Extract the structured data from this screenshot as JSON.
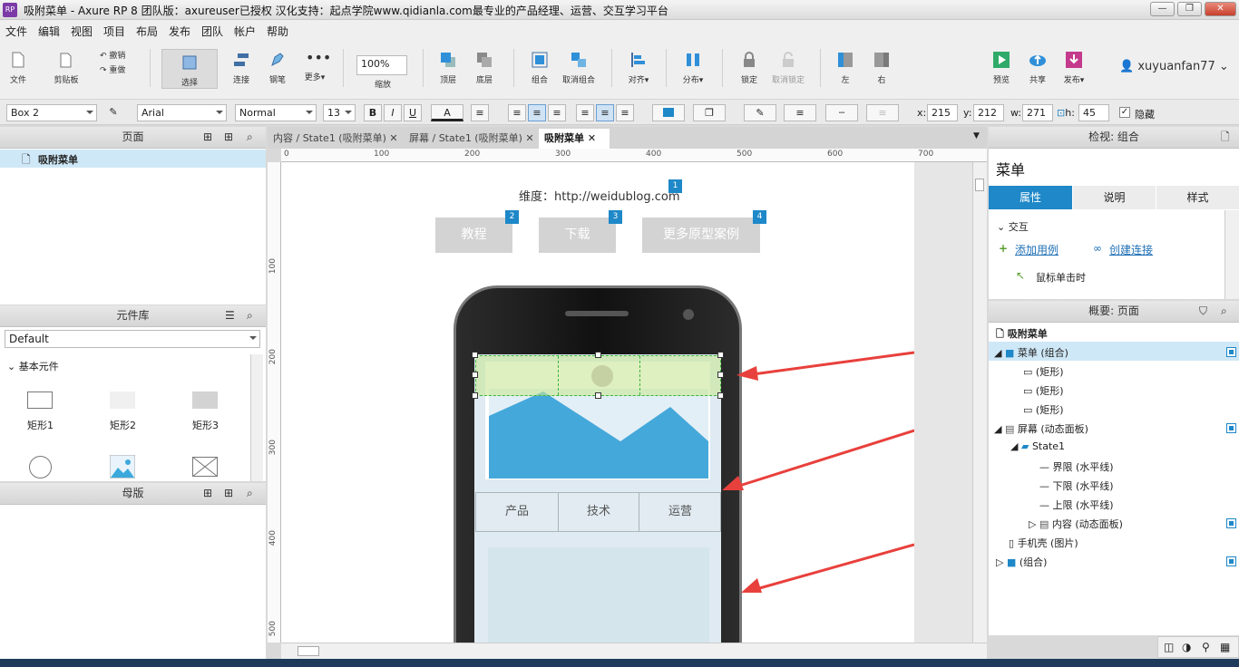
{
  "window": {
    "logo": "RP",
    "title": "吸附菜单 - Axure RP 8 团队版：axureuser已授权 汉化支持：起点学院www.qidianla.com最专业的产品经理、运营、交互学习平台",
    "controls": [
      "—",
      "❐",
      "✕"
    ]
  },
  "menu": [
    "文件",
    "编辑",
    "视图",
    "项目",
    "布局",
    "发布",
    "团队",
    "帐户",
    "帮助"
  ],
  "toolbar": {
    "file": "文件",
    "clipboard": "剪贴板",
    "undo": "撤销",
    "redo": "重做",
    "select": "选择",
    "connect": "连接",
    "pen": "钢笔",
    "more": "更多▾",
    "zoom_value": "100%",
    "zoom": "缩放",
    "top": "顶层",
    "bottom": "底层",
    "group": "组合",
    "ungroup": "取消组合",
    "align": "对齐▾",
    "distribute": "分布▾",
    "lock": "锁定",
    "unlock": "取消锁定",
    "left": "左",
    "right": "右",
    "preview": "预览",
    "share": "共享",
    "publish": "发布▾",
    "user": "xuyuanfan77"
  },
  "formatbar": {
    "widget_name": "Box 2",
    "font": "Arial",
    "weight": "Normal",
    "size": "13",
    "bold": "B",
    "italic": "I",
    "underline": "U",
    "font_color": "A",
    "x_label": "x:",
    "x": "215",
    "y_label": "y:",
    "y": "212",
    "w_label": "w:",
    "w": "271",
    "h_label": "h:",
    "h": "45",
    "hidden_label": "隐藏"
  },
  "pages_panel": {
    "title": "页面",
    "items": [
      "吸附菜单"
    ]
  },
  "library_panel": {
    "title": "元件库",
    "selected": "Default",
    "group": "基本元件",
    "items": [
      "矩形1",
      "矩形2",
      "矩形3"
    ]
  },
  "masters_panel": {
    "title": "母版"
  },
  "tabs": [
    "内容 / State1 (吸附菜单)",
    "屏幕 / State1 (吸附菜单)",
    "吸附菜单"
  ],
  "ruler": {
    "x": [
      "0",
      "100",
      "200",
      "300",
      "400",
      "500",
      "600",
      "700"
    ],
    "y": [
      "100",
      "200",
      "300",
      "400",
      "500"
    ]
  },
  "canvas": {
    "url_text": "维度：http://weidublog.com",
    "buttons": [
      "教程",
      "下载",
      "更多原型案例"
    ],
    "badges": [
      "1",
      "2",
      "3",
      "4"
    ],
    "menu_items": [
      "产品",
      "技术",
      "运营"
    ]
  },
  "inspector": {
    "header": "检视: 组合",
    "name": "菜单",
    "tabs": [
      "属性",
      "说明",
      "样式"
    ],
    "section": "交互",
    "add_case": "添加用例",
    "create_link": "创建连接",
    "event": "鼠标单击时"
  },
  "outline": {
    "header": "概要: 页面",
    "items": [
      "吸附菜单",
      "菜单 (组合)",
      "(矩形)",
      "(矩形)",
      "(矩形)",
      "屏幕 (动态面板)",
      "State1",
      "界限 (水平线)",
      "下限 (水平线)",
      "上限 (水平线)",
      "内容 (动态面板)",
      "手机壳 (图片)",
      "(组合)"
    ]
  },
  "colors": {
    "accent": "#1e88c8",
    "selection": "#cfe8f7",
    "arrow": "#e8403c"
  }
}
